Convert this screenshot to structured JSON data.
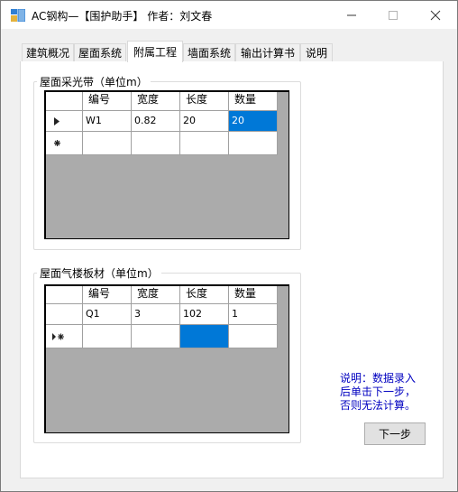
{
  "window": {
    "title": "AC钢构—【围护助手】 作者：刘文春"
  },
  "tabs": [
    {
      "label": "建筑概况"
    },
    {
      "label": "屋面系统"
    },
    {
      "label": "附属工程"
    },
    {
      "label": "墙面系统"
    },
    {
      "label": "输出计算书"
    },
    {
      "label": "说明"
    }
  ],
  "active_tab": "附属工程",
  "skylight": {
    "title": "屋面采光带（单位m）",
    "columns": [
      "编号",
      "宽度",
      "长度",
      "数量"
    ],
    "rows": [
      {
        "cells": [
          "W1",
          "0.82",
          "20",
          "20"
        ]
      }
    ]
  },
  "vent": {
    "title": "屋面气楼板材（单位m）",
    "columns": [
      "编号",
      "宽度",
      "长度",
      "数量"
    ],
    "rows": [
      {
        "cells": [
          "Q1",
          "3",
          "102",
          "1"
        ]
      }
    ]
  },
  "note": {
    "line1": "说明：数据录入",
    "line2": "后单击下一步，",
    "line3": "否则无法计算。"
  },
  "next_button": {
    "label": "下一步"
  },
  "icons": {
    "current_row": "triangle-right",
    "new_row": "asterisk"
  },
  "colors": {
    "selection": "#0078d7",
    "note_text": "#0000c0",
    "grid_empty": "#ababab"
  }
}
